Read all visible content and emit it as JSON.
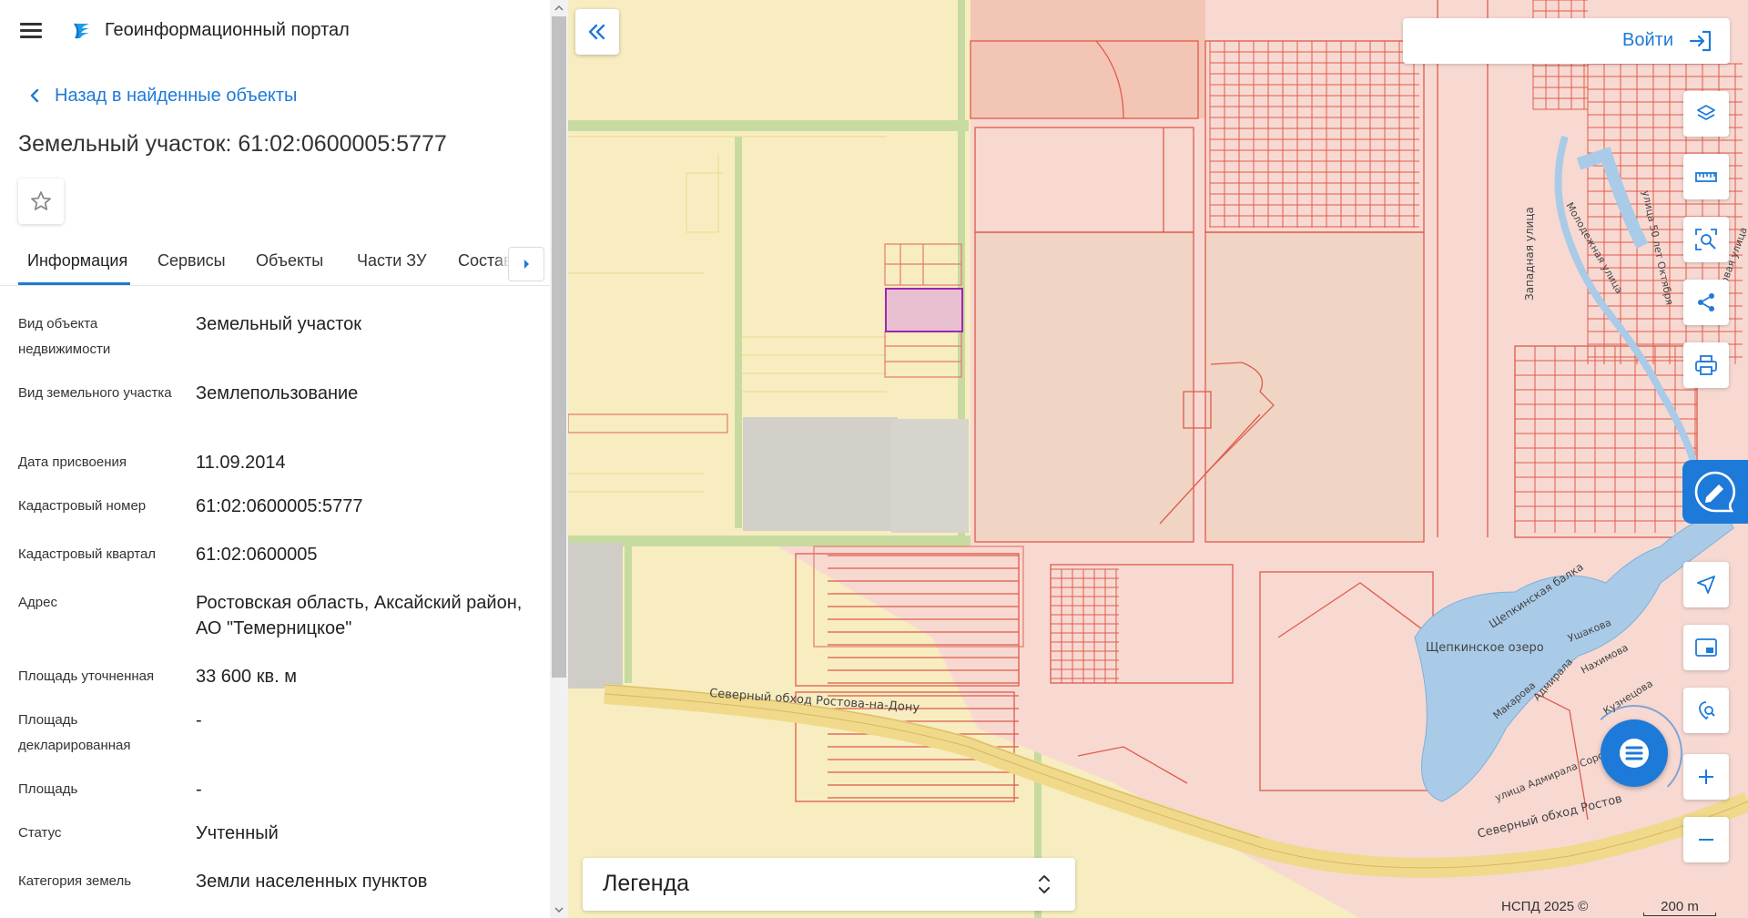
{
  "header": {
    "portal_title": "Геоинформационный портал"
  },
  "navigation": {
    "back_label": "Назад в найденные объекты"
  },
  "object": {
    "title": "Земельный участок: 61:02:0600005:5777"
  },
  "tabs": [
    {
      "label": "Информация",
      "active": true
    },
    {
      "label": "Сервисы",
      "active": false
    },
    {
      "label": "Объекты",
      "active": false
    },
    {
      "label": "Части ЗУ",
      "active": false
    },
    {
      "label": "Состав",
      "active": false
    }
  ],
  "info_rows": [
    {
      "label": "Вид объекта недвижимости",
      "value": "Земельный участок"
    },
    {
      "label": "Вид земельного участка",
      "value": "Землепользование"
    },
    {
      "label": "Дата присвоения",
      "value": "11.09.2014"
    },
    {
      "label": "Кадастровый номер",
      "value": "61:02:0600005:5777"
    },
    {
      "label": "Кадастровый квартал",
      "value": "61:02:0600005"
    },
    {
      "label": "Адрес",
      "value": "Ростовская область, Аксайский район, АО \"Темерницкое\""
    },
    {
      "label": "Площадь уточненная",
      "value": "33 600 кв. м"
    },
    {
      "label": "Площадь декларированная",
      "value": "-"
    },
    {
      "label": "Площадь",
      "value": "-"
    },
    {
      "label": "Статус",
      "value": "Учтенный"
    },
    {
      "label": "Категория земель",
      "value": "Земли населенных пунктов"
    }
  ],
  "map": {
    "login_label": "Войти",
    "legend_title": "Легенда",
    "copyright": "НСПД 2025 ©",
    "scale_label": "200 m",
    "street_labels": {
      "road": "Северный обход Ростова-на-Дону",
      "road_east": "Северный обход Ростов",
      "lake": "Щепкинское озеро",
      "ravine": "Щепкинская балка",
      "west_street": "Западная улица",
      "youth_street": "Молодежная улица",
      "october_street": "улица 50 лет Октября",
      "new_street": "Новая улица",
      "sorokin_street": "улица Адмирала Сорокина",
      "nakhimov_street": "Нахимова",
      "ushakov_street": "Ушакова",
      "kuznetsov_street": "Кузнецова",
      "makarov_street": "Макарова",
      "admiral_street": "Адмирала"
    },
    "tools": [
      {
        "name": "layers",
        "icon": "layers-icon"
      },
      {
        "name": "measure",
        "icon": "ruler-icon"
      },
      {
        "name": "select-area",
        "icon": "area-search-icon"
      },
      {
        "name": "share",
        "icon": "share-icon"
      },
      {
        "name": "print",
        "icon": "print-icon"
      },
      {
        "name": "navigate",
        "icon": "navigation-arrow-icon"
      },
      {
        "name": "minimap",
        "icon": "minimap-icon"
      },
      {
        "name": "geo-search",
        "icon": "location-search-icon"
      },
      {
        "name": "zoom-in",
        "icon": "plus-icon"
      },
      {
        "name": "zoom-out",
        "icon": "minus-icon"
      }
    ]
  },
  "colors": {
    "accent": "#1e7ad8",
    "settlement_fill": "#f7d9d2",
    "settlement_border": "#e05a4a",
    "agro_fill": "#f7edc0",
    "selected_border": "#9c27b0",
    "water": "#a9cbe8",
    "road": "#f0d98a"
  }
}
